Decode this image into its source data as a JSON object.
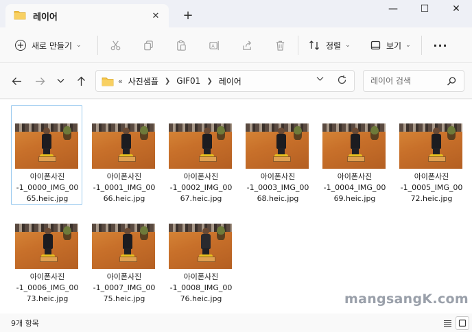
{
  "window": {
    "tab_title": "레이어",
    "tab_close": "✕",
    "new_tab": "+",
    "minimize": "—",
    "maximize": "☐",
    "close": "✕"
  },
  "commandbar": {
    "new_label": "새로 만들기",
    "sort_label": "정렬",
    "view_label": "보기",
    "more_label": "···"
  },
  "address": {
    "overflow": "«",
    "crumbs": [
      "사진샘플",
      "GIF01",
      "레이어"
    ]
  },
  "search": {
    "placeholder": "레이어 검색"
  },
  "files": [
    {
      "name": "아이폰사진\n-1_0000_IMG_00\n65.heic.jpg",
      "selected": true
    },
    {
      "name": "아이폰사진\n-1_0001_IMG_00\n66.heic.jpg",
      "selected": false
    },
    {
      "name": "아이폰사진\n-1_0002_IMG_00\n67.heic.jpg",
      "selected": false
    },
    {
      "name": "아이폰사진\n-1_0003_IMG_00\n68.heic.jpg",
      "selected": false
    },
    {
      "name": "아이폰사진\n-1_0004_IMG_00\n69.heic.jpg",
      "selected": false
    },
    {
      "name": "아이폰사진\n-1_0005_IMG_00\n72.heic.jpg",
      "selected": false
    },
    {
      "name": "아이폰사진\n-1_0006_IMG_00\n73.heic.jpg",
      "selected": false
    },
    {
      "name": "아이폰사진\n-1_0007_IMG_00\n75.heic.jpg",
      "selected": false
    },
    {
      "name": "아이폰사진\n-1_0008_IMG_00\n76.heic.jpg",
      "selected": false
    }
  ],
  "status": {
    "item_count": "9개 항목"
  },
  "watermark": "mangsangK.com",
  "colors": {
    "accent": "#0067c0",
    "folder": "#f3c244",
    "selection_border": "#99c9ef"
  }
}
